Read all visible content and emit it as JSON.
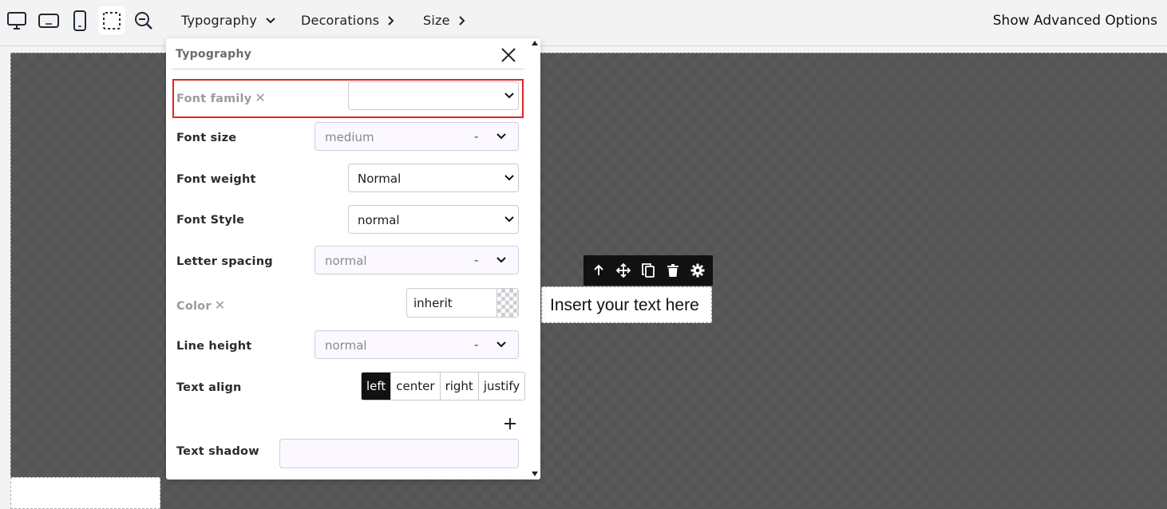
{
  "toolbar": {
    "devices": [
      {
        "icon": "desktop-icon"
      },
      {
        "icon": "tablet-landscape-icon"
      },
      {
        "icon": "mobile-icon"
      },
      {
        "icon": "select-outline-icon"
      },
      {
        "icon": "zoom-out-icon"
      }
    ],
    "nav": [
      {
        "label": "Typography",
        "chevron": "chevron-down-icon"
      },
      {
        "label": "Decorations",
        "chevron": "chevron-right-icon"
      },
      {
        "label": "Size",
        "chevron": "chevron-right-icon"
      }
    ],
    "advanced_label": "Show Advanced Options"
  },
  "panel": {
    "title": "Typography",
    "rows": {
      "font_family": {
        "label": "Font family",
        "clear": "✕",
        "value": ""
      },
      "font_size": {
        "label": "Font size",
        "placeholder": "medium",
        "unit": "-"
      },
      "font_weight": {
        "label": "Font weight",
        "value": "Normal"
      },
      "font_style": {
        "label": "Font Style",
        "value": "normal"
      },
      "letter_spacing": {
        "label": "Letter spacing",
        "placeholder": "normal",
        "unit": "-"
      },
      "color": {
        "label": "Color",
        "clear": "✕",
        "value": "inherit"
      },
      "line_height": {
        "label": "Line height",
        "placeholder": "normal",
        "unit": "-"
      },
      "text_align": {
        "label": "Text align",
        "options": [
          "left",
          "center",
          "right",
          "justify"
        ],
        "selected": "left"
      },
      "text_shadow": {
        "label": "Text shadow",
        "value": ""
      }
    }
  },
  "canvas": {
    "text_block": "Insert your text here",
    "element_toolbar": [
      "arrow-up-icon",
      "move-icon",
      "copy-icon",
      "delete-icon",
      "settings-icon"
    ]
  },
  "colors": {
    "highlight": "#e02424",
    "canvas_bg": "#595959",
    "active_align": "#111111"
  }
}
